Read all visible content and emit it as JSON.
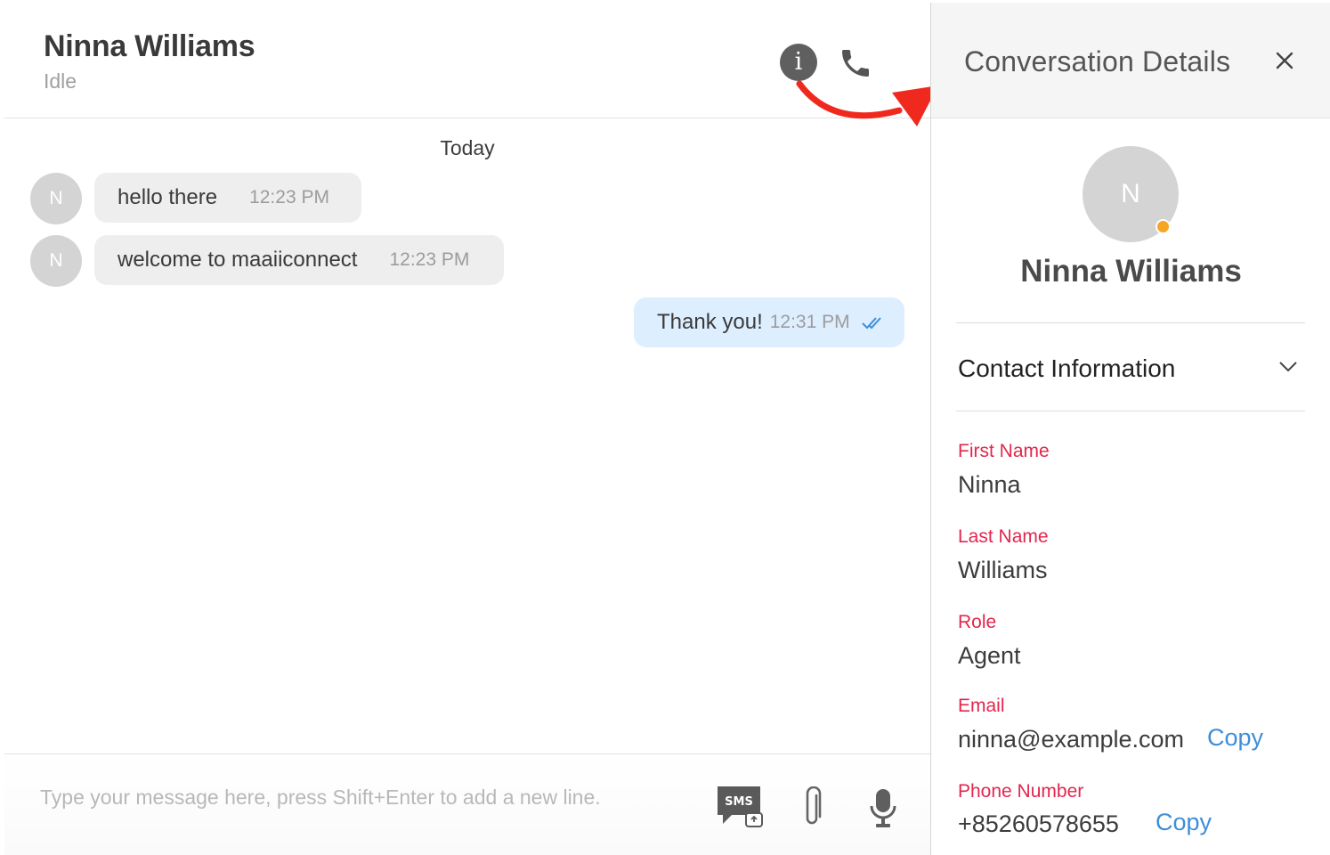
{
  "chat": {
    "contact_name": "Ninna Williams",
    "status": "Idle",
    "day_label": "Today",
    "messages": [
      {
        "text": "hello there",
        "time": "12:23 PM",
        "direction": "incoming",
        "avatar_initial": "N"
      },
      {
        "text": "welcome to maaiiconnect",
        "time": "12:23 PM",
        "direction": "incoming",
        "avatar_initial": "N"
      },
      {
        "text": "Thank you!",
        "time": "12:31 PM",
        "direction": "outgoing",
        "read": true
      }
    ],
    "composer": {
      "placeholder": "Type your message here, press Shift+Enter to add a new line.",
      "value": "",
      "sms_icon_text": "SMS"
    },
    "icons": [
      "info-icon",
      "phone-icon",
      "sms-lock-icon",
      "paperclip-icon",
      "microphone-icon"
    ]
  },
  "details": {
    "title": "Conversation Details",
    "avatar_initial": "N",
    "presence_color": "#f5a623",
    "name": "Ninna Williams",
    "section_title": "Contact Information",
    "fields": {
      "first_name": {
        "label": "First Name",
        "value": "Ninna"
      },
      "last_name": {
        "label": "Last Name",
        "value": "Williams"
      },
      "role": {
        "label": "Role",
        "value": "Agent"
      },
      "email": {
        "label": "Email",
        "value": "ninna@example.com",
        "action": "Copy"
      },
      "phone": {
        "label": "Phone Number",
        "value": "+85260578655",
        "action": "Copy"
      }
    }
  },
  "colors": {
    "label_red": "#e3264d",
    "link_blue": "#3e8ed8",
    "annotation_arrow": "#f0291f",
    "outgoing_bubble": "#ddeeff",
    "incoming_bubble": "#eeeeee"
  }
}
